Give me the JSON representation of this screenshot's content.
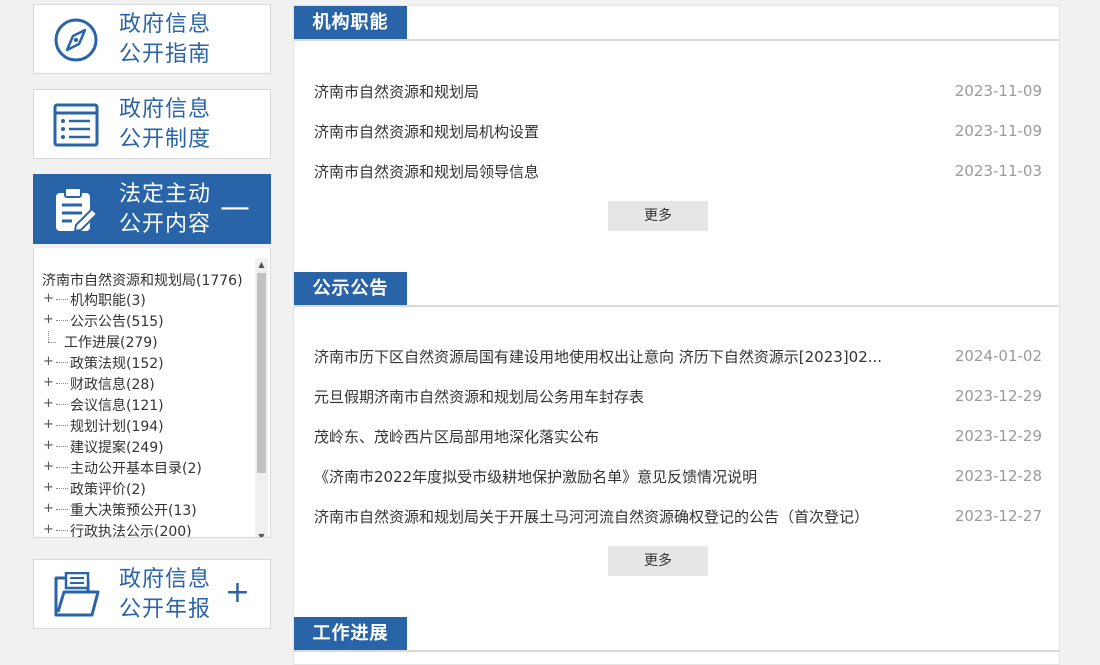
{
  "sidebar": {
    "cards": [
      {
        "line1": "政府信息",
        "line2": "公开指南",
        "icon": "compass-icon"
      },
      {
        "line1": "政府信息",
        "line2": "公开制度",
        "icon": "list-document-icon"
      },
      {
        "line1": "法定主动",
        "line2": "公开内容",
        "icon": "clipboard-edit-icon",
        "sign": "—"
      },
      {
        "line1": "政府信息",
        "line2": "公开年报",
        "icon": "folder-report-icon",
        "sign": "+"
      }
    ],
    "tree": {
      "root": "济南市自然资源和规划局(1776)",
      "items": [
        {
          "label": "机构职能(3)",
          "toggle": "+"
        },
        {
          "label": "公示公告(515)",
          "toggle": "+"
        },
        {
          "label": "工作进展(279)",
          "toggle": ""
        },
        {
          "label": "政策法规(152)",
          "toggle": "+"
        },
        {
          "label": "财政信息(28)",
          "toggle": "+"
        },
        {
          "label": "会议信息(121)",
          "toggle": "+"
        },
        {
          "label": "规划计划(194)",
          "toggle": "+"
        },
        {
          "label": "建议提案(249)",
          "toggle": "+"
        },
        {
          "label": "主动公开基本目录(2)",
          "toggle": "+"
        },
        {
          "label": "政策评价(2)",
          "toggle": "+"
        },
        {
          "label": "重大决策预公开(13)",
          "toggle": "+"
        },
        {
          "label": "行政执法公示(200)",
          "toggle": "+"
        }
      ],
      "scroll_up": "▲",
      "scroll_down": "▼"
    }
  },
  "sections": [
    {
      "title": "机构职能",
      "rows": [
        {
          "text": "济南市自然资源和规划局",
          "date": "2023-11-09"
        },
        {
          "text": "济南市自然资源和规划局机构设置",
          "date": "2023-11-09"
        },
        {
          "text": "济南市自然资源和规划局领导信息",
          "date": "2023-11-03"
        }
      ],
      "more": "更多"
    },
    {
      "title": "公示公告",
      "rows": [
        {
          "text": "济南市历下区自然资源局国有建设用地使用权出让意向 济历下自然资源示[2023]02...",
          "date": "2024-01-02"
        },
        {
          "text": "元旦假期济南市自然资源和规划局公务用车封存表",
          "date": "2023-12-29"
        },
        {
          "text": "茂岭东、茂岭西片区局部用地深化落实公布",
          "date": "2023-12-29"
        },
        {
          "text": "《济南市2022年度拟受市级耕地保护激励名单》意见反馈情况说明",
          "date": "2023-12-28"
        },
        {
          "text": "济南市自然资源和规划局关于开展土马河河流自然资源确权登记的公告（首次登记）",
          "date": "2023-12-27"
        }
      ],
      "more": "更多"
    },
    {
      "title": "工作进展",
      "rows": [],
      "more": ""
    }
  ],
  "colors": {
    "accent": "#2a64a8",
    "date": "#9a9a9a",
    "rule": "#d9d9d9"
  }
}
